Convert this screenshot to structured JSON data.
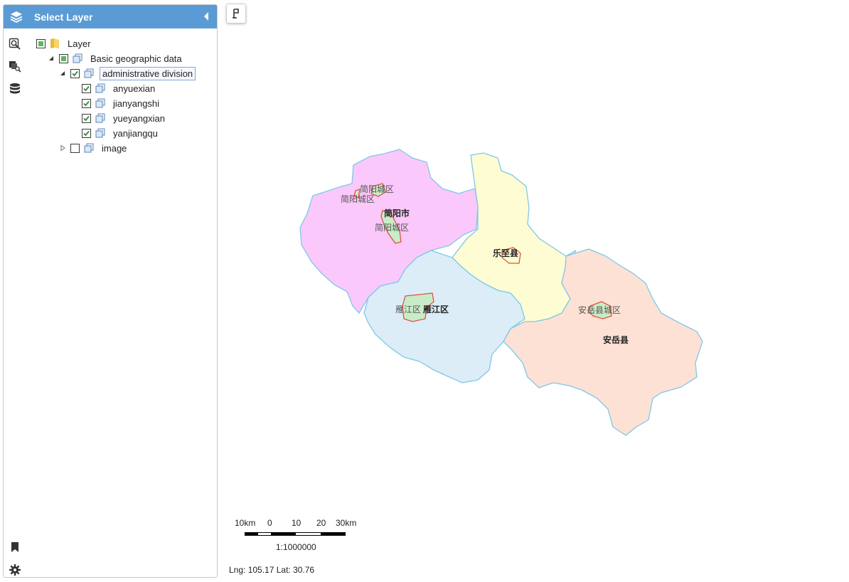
{
  "panel": {
    "title": "Select Layer",
    "header_icon": "layers-icon",
    "collapse_icon": "collapse-left-icon"
  },
  "toolbar": [
    {
      "icon": "zoom-search-icon"
    },
    {
      "icon": "layer-query-icon"
    },
    {
      "icon": "database-icon"
    },
    {
      "icon": "bookmark-icon"
    },
    {
      "icon": "gear-icon"
    }
  ],
  "tree": {
    "root": {
      "label": "Layer",
      "state": "partial"
    },
    "group": {
      "label": "Basic geographic data",
      "state": "partial",
      "expanded": true
    },
    "admin": {
      "label": "administrative division",
      "state": "checked",
      "expanded": true,
      "selected": true
    },
    "children": [
      {
        "label": "anyuexian",
        "state": "checked"
      },
      {
        "label": "jianyangshi",
        "state": "checked"
      },
      {
        "label": "yueyangxian",
        "state": "checked"
      },
      {
        "label": "yanjiangqu",
        "state": "checked"
      }
    ],
    "image": {
      "label": "image",
      "state": "unchecked",
      "expanded": false
    }
  },
  "map": {
    "tool_icon": "flag-icon",
    "colors": {
      "jianyang": "#fbc8fb",
      "lezhi": "#fdfcd2",
      "yanjiang": "#dcedf8",
      "anyue": "#fde1d5",
      "border": "#7ec8e8",
      "urban_fill": "#c9ecc8",
      "urban_border": "#e0523f"
    },
    "labels": {
      "jianyang": "简阳市",
      "lezhi": "乐至县",
      "yanjiang": "雁江区",
      "anyue": "安岳县",
      "jy_urban_1": "简阳城区",
      "jy_urban_2": "简阳城区",
      "jy_urban_3": "简阳城区",
      "yj_urban": "雁江区",
      "ay_urban": "安岳县城区"
    }
  },
  "scale": {
    "ticks": [
      "10km",
      "0",
      "10",
      "20",
      "30km"
    ],
    "ratio": "1:1000000"
  },
  "coords": "Lng: 105.17 Lat: 30.76"
}
